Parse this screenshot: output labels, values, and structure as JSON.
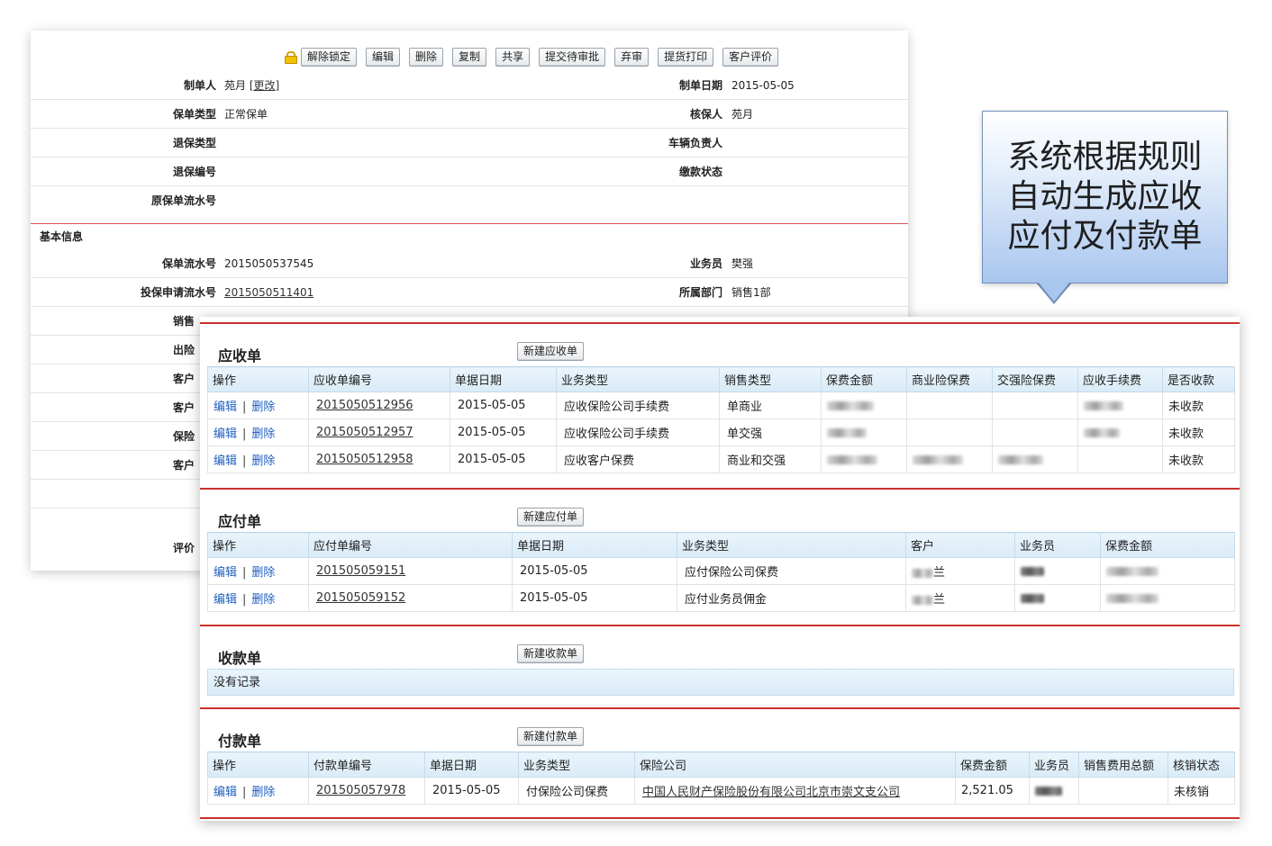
{
  "toolbar": {
    "buttons": [
      "解除锁定",
      "编辑",
      "删除",
      "复制",
      "共享",
      "提交待审批",
      "弃审",
      "提货打印",
      "客户评价"
    ]
  },
  "back": {
    "rows": [
      {
        "label": "制单人",
        "value": "苑月",
        "link": "[更改]",
        "label2": "制单日期",
        "value2": "2015-05-05"
      },
      {
        "label": "保单类型",
        "value": "正常保单",
        "label2": "核保人",
        "value2": "苑月"
      },
      {
        "label": "退保类型",
        "value": "",
        "label2": "车辆负责人",
        "value2": ""
      },
      {
        "label": "退保编号",
        "value": "",
        "label2": "缴款状态",
        "value2": ""
      },
      {
        "label": "原保单流水号",
        "value": "",
        "label2": "",
        "value2": ""
      }
    ],
    "section_title": "基本信息",
    "rows2": [
      {
        "label": "保单流水号",
        "value": "2015050537545",
        "label2": "业务员",
        "value2": "樊强"
      },
      {
        "label": "投保申请流水号",
        "value": "2015050511401",
        "label2": "所属部门",
        "value2": "销售1部"
      }
    ],
    "partial_labels": [
      "销售",
      "出险",
      "客户",
      "客户",
      "保险",
      "客户",
      "",
      "",
      "评价"
    ]
  },
  "callout": {
    "text": "系统根据规则自动生成应收应付及付款单"
  },
  "receivable": {
    "title": "应收单",
    "new_button": "新建应收单",
    "headers": [
      "操作",
      "应收单编号",
      "单据日期",
      "业务类型",
      "销售类型",
      "保费金额",
      "商业险保费",
      "交强险保费",
      "应收手续费",
      "是否收款"
    ],
    "rows": [
      {
        "id": "2015050512956",
        "date": "2015-05-05",
        "type": "应收保险公司手续费",
        "sale": "单商业",
        "status": "未收款"
      },
      {
        "id": "2015050512957",
        "date": "2015-05-05",
        "type": "应收保险公司手续费",
        "sale": "单交强",
        "status": "未收款"
      },
      {
        "id": "2015050512958",
        "date": "2015-05-05",
        "type": "应收客户保费",
        "sale": "商业和交强",
        "status": "未收款"
      }
    ]
  },
  "payable": {
    "title": "应付单",
    "new_button": "新建应付单",
    "headers": [
      "操作",
      "应付单编号",
      "单据日期",
      "业务类型",
      "客户",
      "业务员",
      "保费金额"
    ],
    "rows": [
      {
        "id": "201505059151",
        "date": "2015-05-05",
        "type": "应付保险公司保费",
        "customer_suffix": "兰"
      },
      {
        "id": "201505059152",
        "date": "2015-05-05",
        "type": "应付业务员佣金",
        "customer_suffix": "兰"
      }
    ]
  },
  "receipt": {
    "title": "收款单",
    "new_button": "新建收款单",
    "empty_text": "没有记录"
  },
  "payment": {
    "title": "付款单",
    "new_button": "新建付款单",
    "headers": [
      "操作",
      "付款单编号",
      "单据日期",
      "业务类型",
      "保险公司",
      "保费金额",
      "业务员",
      "销售费用总额",
      "核销状态"
    ],
    "rows": [
      {
        "id": "201505057978",
        "date": "2015-05-05",
        "type": "付保险公司保费",
        "company": "中国人民财产保险股份有限公司北京市崇文支公司",
        "amount": "2,521.05",
        "status": "未核销"
      }
    ]
  },
  "actions": {
    "edit": "编辑",
    "sep": "|",
    "delete": "删除"
  },
  "colors": {
    "accent_red": "#c9302c",
    "link_blue": "#1f5fbf",
    "header_blue": "#d9ebf7"
  }
}
